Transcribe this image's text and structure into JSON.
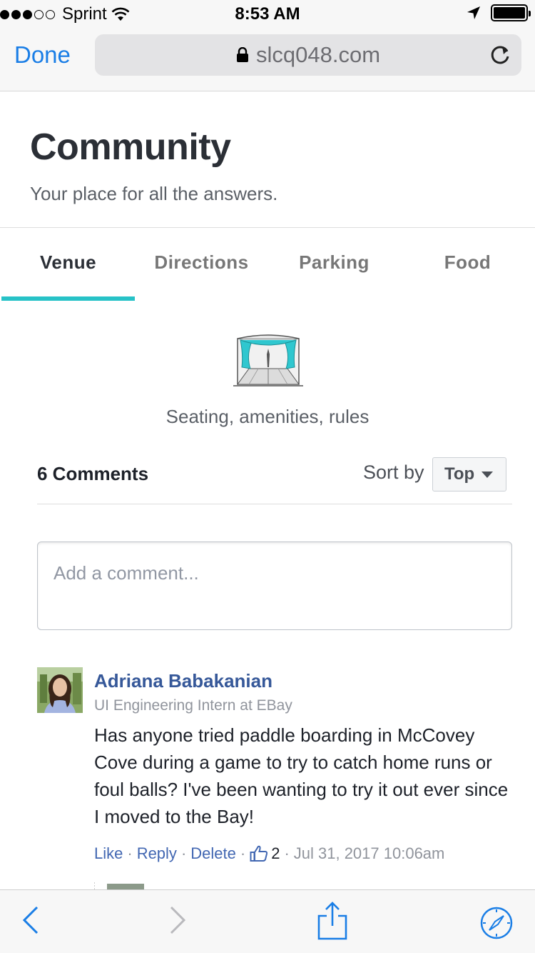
{
  "status_bar": {
    "carrier": "Sprint",
    "time": "8:53 AM",
    "signal_filled": 3,
    "signal_total": 5,
    "icons": [
      "wifi-icon",
      "location-arrow-icon",
      "battery-icon"
    ]
  },
  "browser": {
    "done_label": "Done",
    "url": "slcq048.com"
  },
  "page": {
    "title": "Community",
    "subtitle": "Your place for all the answers."
  },
  "tabs": [
    {
      "label": "Venue",
      "active": true
    },
    {
      "label": "Directions",
      "active": false
    },
    {
      "label": "Parking",
      "active": false
    },
    {
      "label": "Food",
      "active": false
    }
  ],
  "venue": {
    "caption": "Seating, amenities, rules"
  },
  "comments": {
    "count_label": "6 Comments",
    "sort_label": "Sort by",
    "sort_value": "Top",
    "input_placeholder": "Add a comment...",
    "items": [
      {
        "author": "Adriana Babakanian",
        "role": "UI Engineering Intern at EBay",
        "body": "Has anyone tried paddle boarding in McCovey Cove during a game to try to catch home runs or foul balls? I've been wanting to try it out ever since I moved to the Bay!",
        "like_label": "Like",
        "reply_label": "Reply",
        "delete_label": "Delete",
        "like_count": "2",
        "timestamp": "Jul 31, 2017 10:06am"
      }
    ]
  },
  "colors": {
    "accent": "#27c2c7",
    "link": "#4267b2",
    "ios_blue": "#1a7ee6"
  }
}
